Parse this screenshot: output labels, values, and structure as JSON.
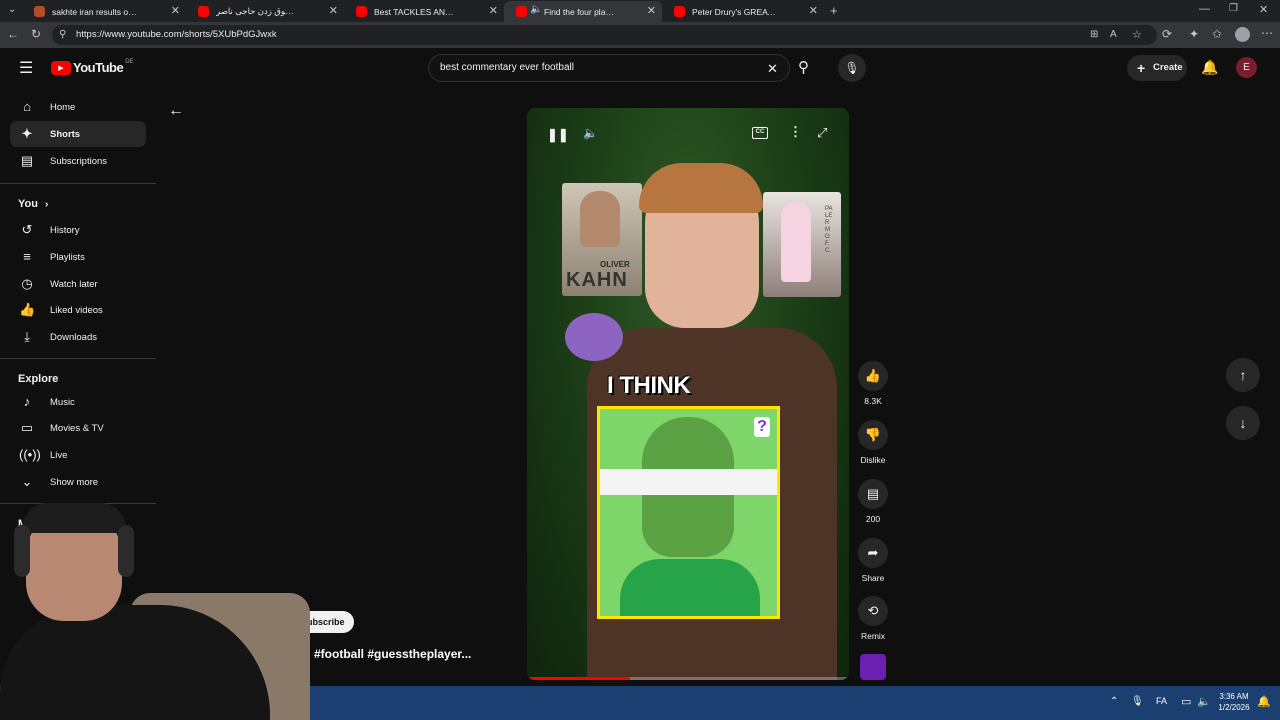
{
  "browser": {
    "tabs": [
      {
        "title": "sakhte iran results on SoundClou",
        "favicon": "soundcloud-icon",
        "active": false
      },
      {
        "title": "بوق زدن حاجی ناصر 💗 - YouTube",
        "favicon": "youtube-icon",
        "active": false
      },
      {
        "title": "Best TACKLES AND BLOCKS | Serg",
        "favicon": "youtube-icon",
        "active": false
      },
      {
        "title": "Find the four players! #footb",
        "favicon": "youtube-icon",
        "active": true
      },
      {
        "title": "Peter Drury's GREATEST Commen",
        "favicon": "youtube-icon",
        "active": false
      }
    ],
    "url": "https://www.youtube.com/shorts/5XUbPdGJwxk"
  },
  "youtube": {
    "logo_text": "YouTube",
    "region": "DE",
    "search_query": "best commentary ever football",
    "create_label": "Create",
    "avatar_letter": "E"
  },
  "sidebar": {
    "primary": [
      {
        "label": "Home",
        "icon": "home-icon"
      },
      {
        "label": "Shorts",
        "icon": "shorts-icon",
        "active": true
      },
      {
        "label": "Subscriptions",
        "icon": "subscriptions-icon"
      }
    ],
    "you_heading": "You",
    "you_items": [
      {
        "label": "History",
        "icon": "history-icon"
      },
      {
        "label": "Playlists",
        "icon": "playlists-icon"
      },
      {
        "label": "Watch later",
        "icon": "watch-later-icon"
      },
      {
        "label": "Liked videos",
        "icon": "liked-icon"
      },
      {
        "label": "Downloads",
        "icon": "download-icon"
      }
    ],
    "explore_heading": "Explore",
    "explore_items": [
      {
        "label": "Music",
        "icon": "music-icon"
      },
      {
        "label": "Movies & TV",
        "icon": "movies-icon"
      },
      {
        "label": "Live",
        "icon": "live-icon"
      },
      {
        "label": "Show more",
        "icon": "chevron-down-icon"
      }
    ],
    "partial_heading": "M"
  },
  "short": {
    "caption_overlay": "I THINK",
    "card_left_name": "OLIVER",
    "card_left_surname": "KAHN",
    "card_right_text": "PALERMO F.C.",
    "question_mark": "?",
    "subscribe_label": "ubscribe",
    "title": "#football #guesstheplayer...",
    "progress": 0.32
  },
  "actions": {
    "like_count": "8.3K",
    "dislike_label": "Dislike",
    "comments_count": "200",
    "share_label": "Share",
    "remix_label": "Remix"
  },
  "taskbar": {
    "time": "3:36 AM",
    "date": "1/2/2026",
    "lang": "FA"
  },
  "colors": {
    "youtube_red": "#ff0000",
    "background": "#0f0f0f",
    "taskbar": "#1a3f70",
    "highlight_yellow": "#ffe600"
  }
}
